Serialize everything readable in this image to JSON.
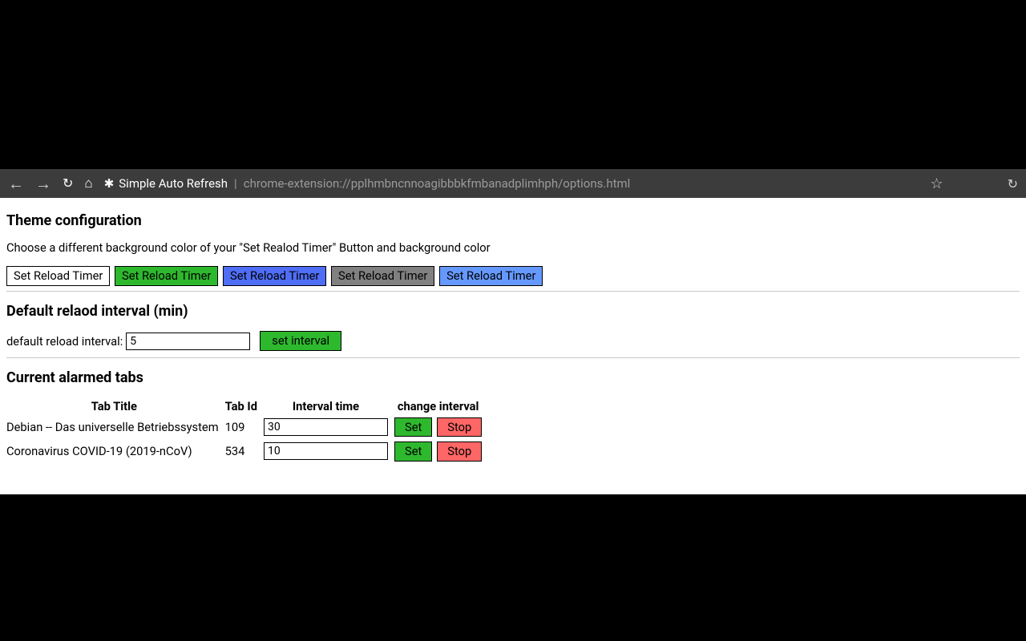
{
  "browser": {
    "page_title": "Simple Auto Refresh",
    "url": "chrome-extension://pplhmbncnnoagibbbkfmbanadplimhph/options.html"
  },
  "theme": {
    "heading": "Theme configuration",
    "description": "Choose a different background color of your \"Set Realod Timer\" Button and background color",
    "button_label": "Set Reload Timer"
  },
  "default_interval": {
    "heading": "Default relaod interval (min)",
    "label": "default reload interval:",
    "value": "5",
    "set_label": "set interval"
  },
  "tabs": {
    "heading": "Current alarmed tabs",
    "columns": {
      "title": "Tab Title",
      "id": "Tab Id",
      "interval": "Interval time",
      "change": "change interval"
    },
    "set_label": "Set",
    "stop_label": "Stop",
    "rows": [
      {
        "title": "Debian -- Das universelle Betriebssystem",
        "id": "109",
        "interval": "30"
      },
      {
        "title": "Coronavirus COVID-19 (2019-nCoV)",
        "id": "534",
        "interval": "10"
      }
    ]
  }
}
